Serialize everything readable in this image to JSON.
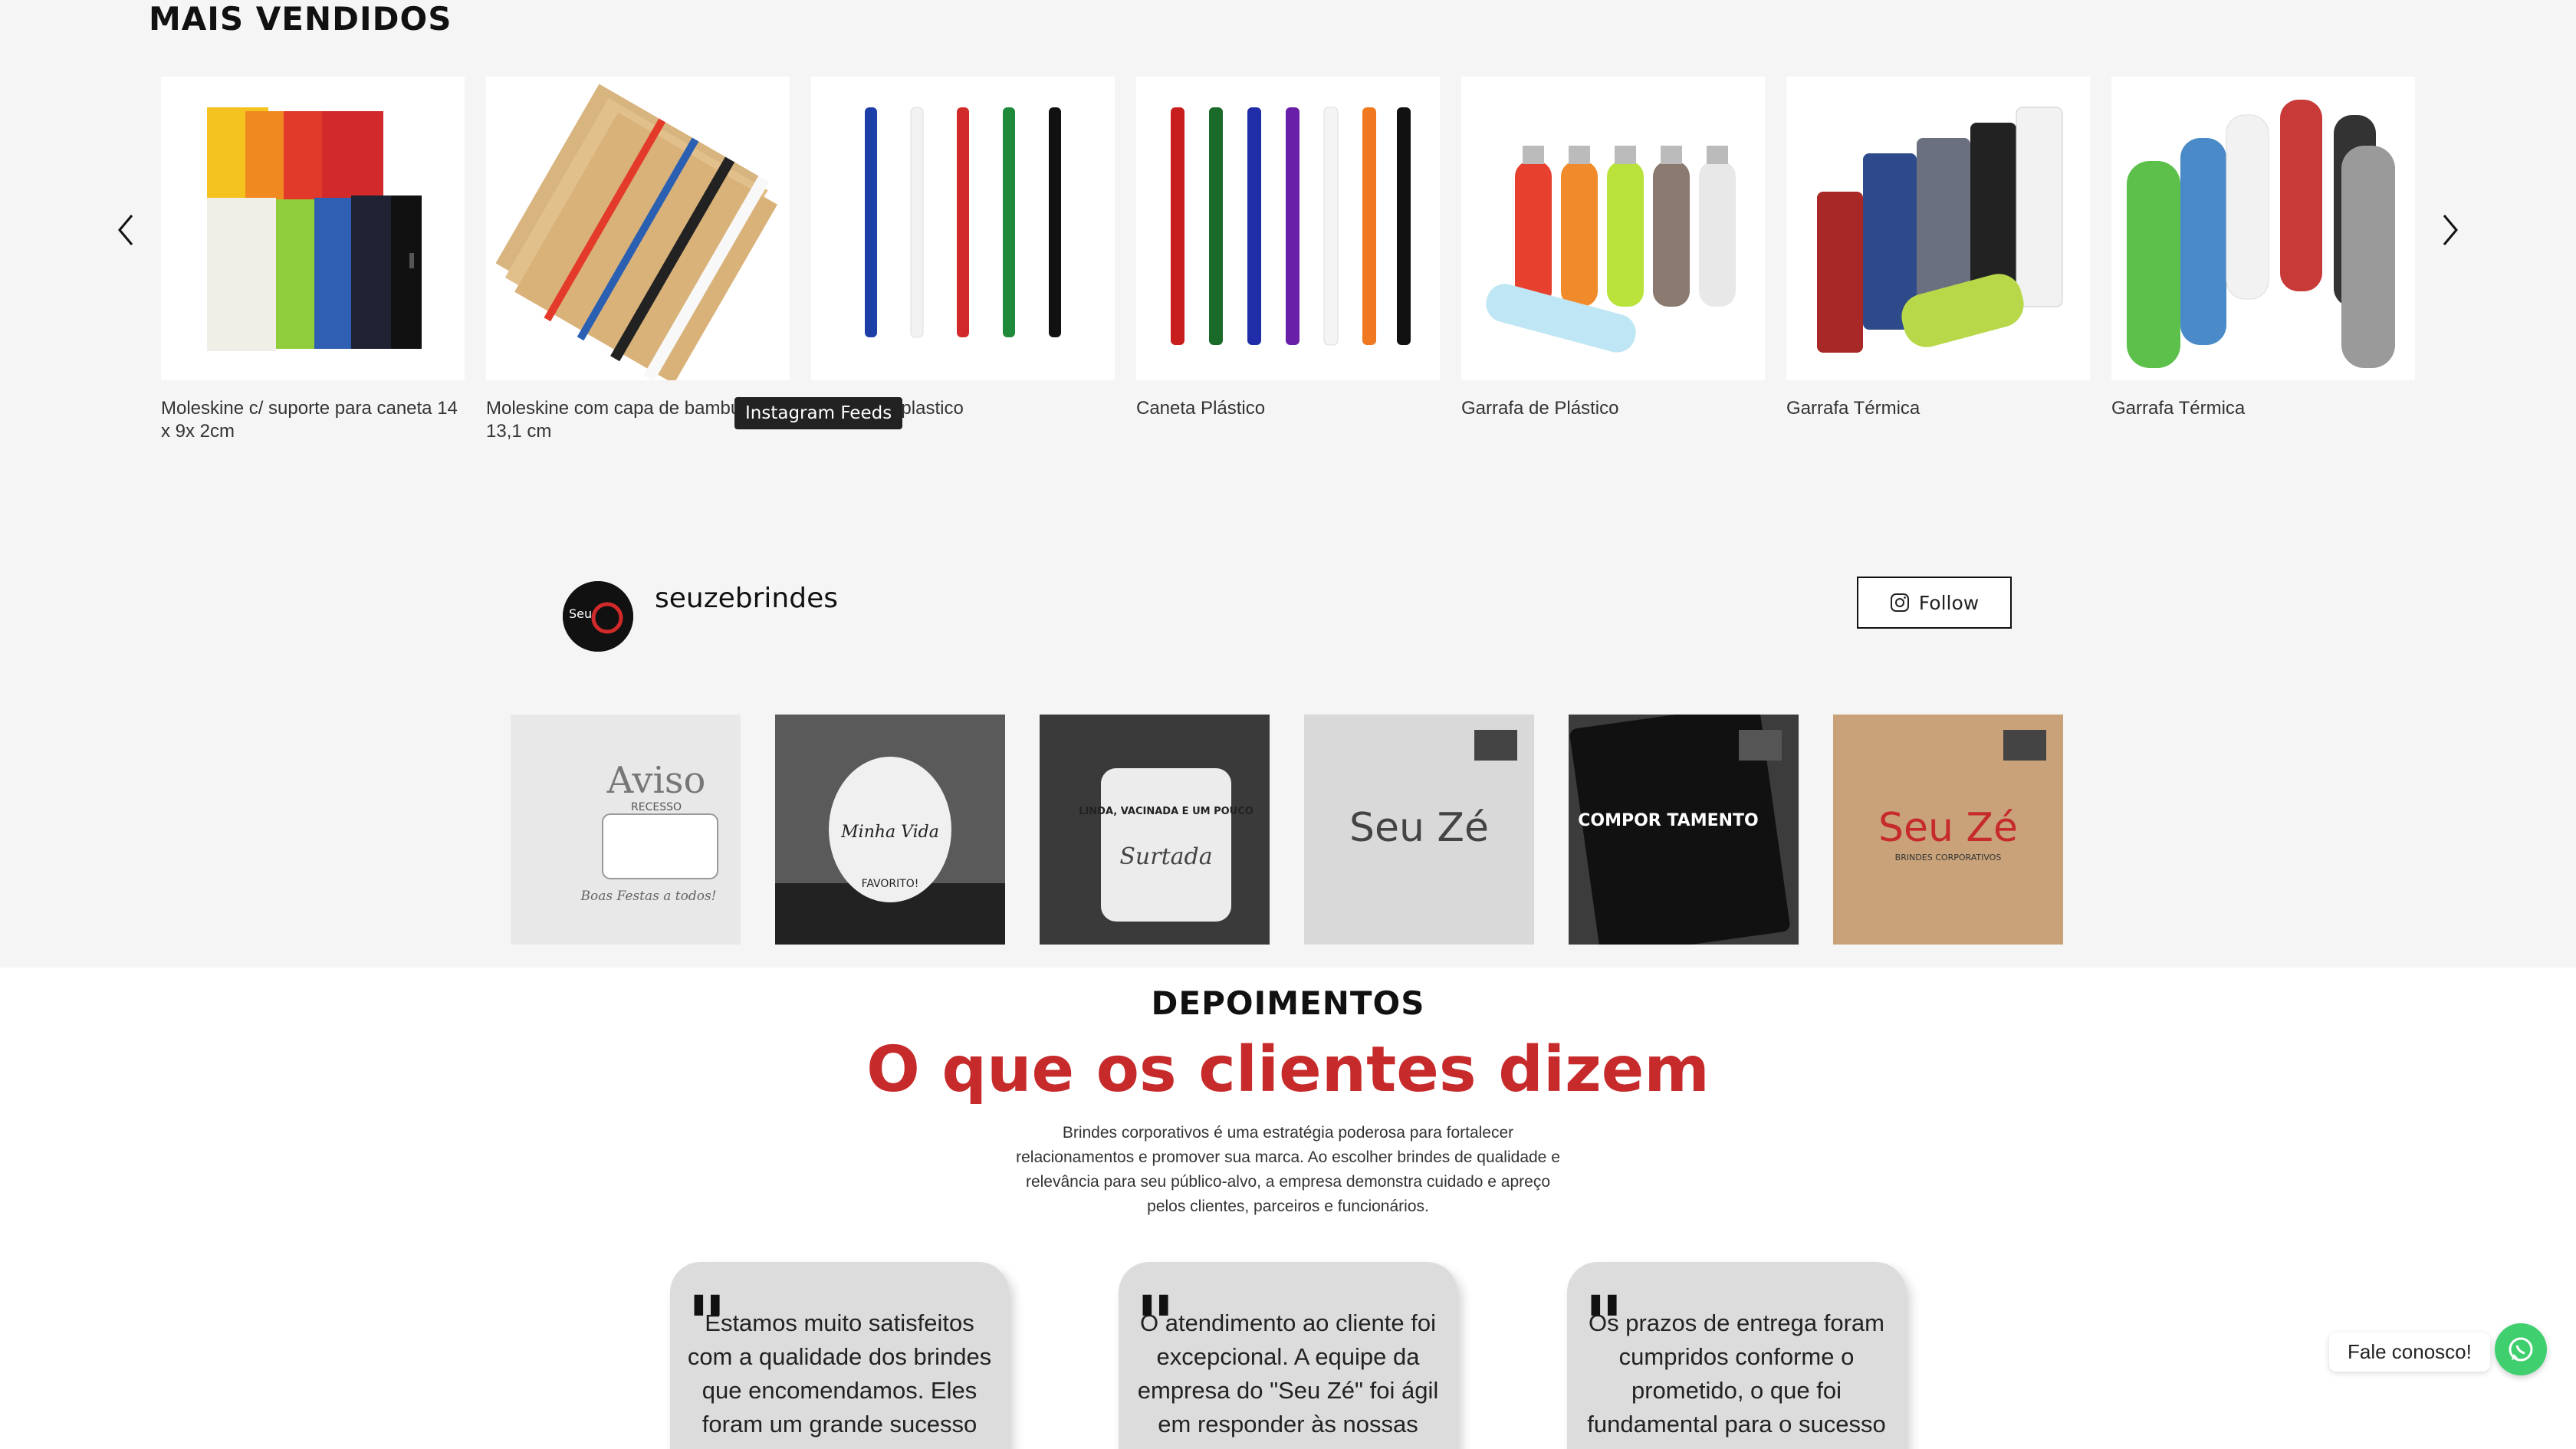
{
  "best_sellers": {
    "title": "MAIS VENDIDOS",
    "prev_icon": "chevron-left-icon",
    "next_icon": "chevron-right-icon",
    "products": [
      {
        "name": "Moleskine c/ suporte para caneta 14 x 9x 2cm"
      },
      {
        "name": "Moleskine com capa de bambu 9 x 13,1 cm"
      },
      {
        "name": "Caneta de plastico"
      },
      {
        "name": "Caneta Plástico"
      },
      {
        "name": "Garrafa de Plástico"
      },
      {
        "name": "Garrafa Térmica"
      },
      {
        "name": "Garrafa Térmica"
      }
    ],
    "tooltip": "Instagram Feeds"
  },
  "instagram": {
    "handle": "seuzebrindes",
    "follow_label": "Follow",
    "posts": [
      {
        "text": "Aviso",
        "subtext": "RECESSO",
        "footer": "Boas Festas a todos!"
      },
      {
        "text": "Minha Vida",
        "subtext": "FAVORITO!"
      },
      {
        "text": "LINDA, VACINADA E UM POUCO",
        "subtext": "Surtada"
      },
      {
        "text": "Seu Zé"
      },
      {
        "text": "COMPOR TAMENTO"
      },
      {
        "text": "Seu Zé",
        "subtext": "BRINDES CORPORATIVOS"
      }
    ]
  },
  "testimonials": {
    "title": "DEPOIMENTOS",
    "heading": "O que os clientes dizem",
    "intro": "Brindes corporativos é uma estratégia poderosa para fortalecer relacionamentos e promover sua marca. Ao escolher brindes de qualidade e relevância para seu público-alvo, a empresa demonstra cuidado e apreço pelos clientes, parceiros e funcionários.",
    "cards": [
      {
        "quote": "Estamos muito satisfeitos com a qualidade dos brindes que encomendamos. Eles foram um grande sucesso"
      },
      {
        "quote": "O atendimento ao cliente foi excepcional. A equipe da empresa do \"Seu Zé\" foi ágil em responder às nossas"
      },
      {
        "quote": "Os prazos de entrega foram cumpridos conforme o prometido, o que foi fundamental para o sucesso"
      }
    ]
  },
  "chat": {
    "label": "Fale conosco!",
    "icon": "whatsapp-icon",
    "color": "#3fcf6e"
  },
  "colors": {
    "accent": "#c62a2a",
    "background": "#f5f5f5"
  }
}
